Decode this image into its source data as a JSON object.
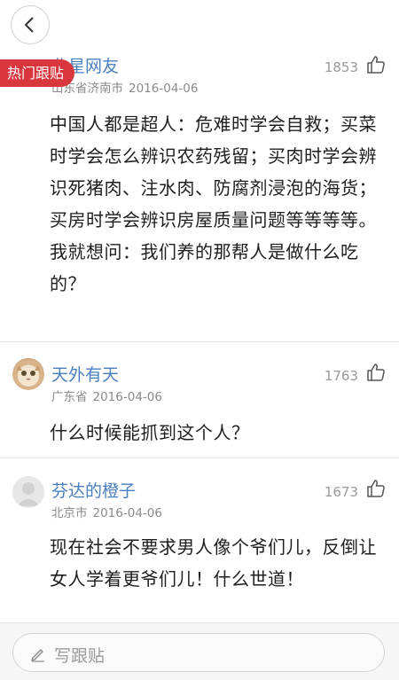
{
  "header": {
    "back_icon": "chevron-left-icon"
  },
  "hot_tag": "热门跟贴",
  "comments": [
    {
      "username": "北星网友",
      "location": "山东省济南市",
      "date": "2016-04-06",
      "likes": "1853",
      "avatar": "none",
      "text": "中国人都是超人：危难时学会自救；买菜时学会怎么辨识农药残留；买肉时学会辨识死猪肉、注水肉、防腐剂浸泡的海货；买房时学会辨识房屋质量问题等等等等。我就想问：我们养的那帮人是做什么吃的？"
    },
    {
      "username": "天外有天",
      "location": "广东省",
      "date": "2016-04-06",
      "likes": "1763",
      "avatar": "cat-photo",
      "text": "什么时候能抓到这个人？"
    },
    {
      "username": "芬达的橙子",
      "location": "北京市",
      "date": "2016-04-06",
      "likes": "1673",
      "avatar": "default-user-icon",
      "text": "现在社会不要求男人像个爷们儿，反倒让女人学着更爷们儿！什么世道！"
    }
  ],
  "footer": {
    "reply_placeholder": "写跟贴",
    "reply_icon": "pencil-icon"
  },
  "colors": {
    "accent_red": "#d9363e",
    "username_blue": "#4a7fbf",
    "meta_gray": "#8a8a8a"
  }
}
